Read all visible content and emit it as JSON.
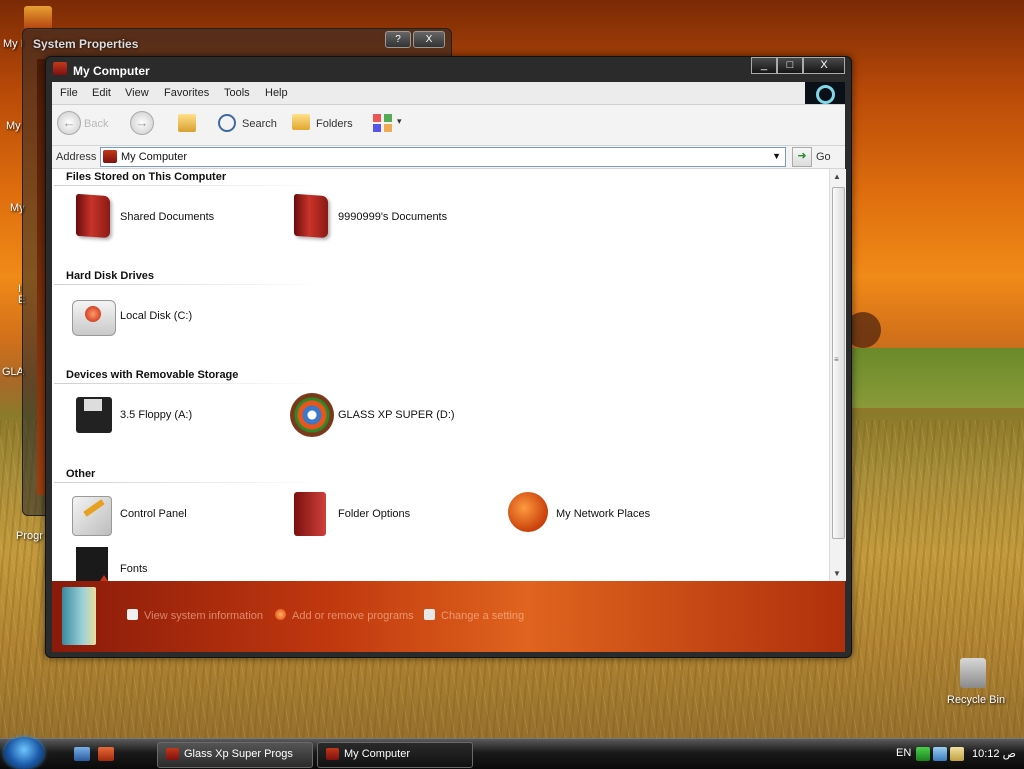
{
  "desktop": {
    "labels": {
      "my1": "My I",
      "my2": "My",
      "my3": "My",
      "ie": "I\nE",
      "gla": "GLA",
      "prog": "Progr",
      "recycle": "Recycle Bin"
    }
  },
  "system_properties": {
    "title": "System Properties",
    "help_btn": "?",
    "close_btn": "X"
  },
  "window": {
    "title": "My Computer",
    "controls": {
      "minimize": "_",
      "maximize": "□",
      "close": "X"
    },
    "menu": [
      "File",
      "Edit",
      "View",
      "Favorites",
      "Tools",
      "Help"
    ],
    "toolbar": {
      "back": "Back",
      "search": "Search",
      "folders": "Folders",
      "views_arrow": "▾"
    },
    "address": {
      "label": "Address",
      "value": "My Computer",
      "go": "Go"
    },
    "groups": [
      {
        "header": "Files Stored on This Computer",
        "items": [
          {
            "label": "Shared Documents",
            "icon": "folder-icon"
          },
          {
            "label": "9990999's Documents",
            "icon": "folder-icon"
          }
        ]
      },
      {
        "header": "Hard Disk Drives",
        "items": [
          {
            "label": "Local Disk (C:)",
            "icon": "hard-disk-icon"
          }
        ]
      },
      {
        "header": "Devices with Removable Storage",
        "items": [
          {
            "label": "3.5 Floppy (A:)",
            "icon": "floppy-icon"
          },
          {
            "label": "GLASS XP SUPER (D:)",
            "icon": "cd-drive-icon"
          }
        ]
      },
      {
        "header": "Other",
        "items": [
          {
            "label": "Control Panel",
            "icon": "control-panel-icon"
          },
          {
            "label": "Folder Options",
            "icon": "folder-options-icon"
          },
          {
            "label": "My Network Places",
            "icon": "network-places-icon"
          },
          {
            "label": "Fonts",
            "icon": "fonts-icon"
          }
        ]
      }
    ],
    "taskpane": {
      "links": [
        "View system information",
        "Add or remove programs",
        "Change a setting"
      ]
    }
  },
  "taskbar": {
    "tasks": [
      "Glass Xp Super Progs",
      "My Computer"
    ],
    "tray_lang": "EN",
    "clock": "10:12 ص"
  },
  "colors": {
    "accent": "#c0380e",
    "window_frame": "#2b2b2b"
  }
}
